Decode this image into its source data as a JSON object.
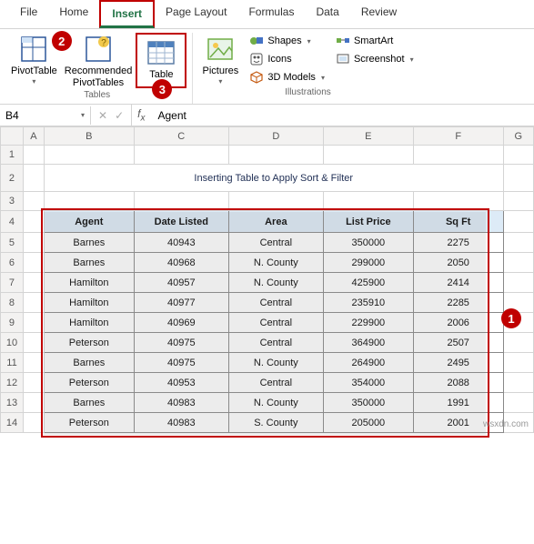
{
  "tabs": [
    "File",
    "Home",
    "Insert",
    "Page Layout",
    "Formulas",
    "Data",
    "Review"
  ],
  "active_tab": "Insert",
  "ribbon": {
    "tables": {
      "pivot": "PivotTable",
      "recommended": "Recommended\nPivotTables",
      "table": "Table",
      "group_label": "Tables"
    },
    "illustrations": {
      "pictures": "Pictures",
      "shapes": "Shapes",
      "icons": "Icons",
      "models": "3D Models",
      "smartart": "SmartArt",
      "screenshot": "Screenshot",
      "group_label": "Illustrations"
    }
  },
  "badges": {
    "b1": "1",
    "b2": "2",
    "b3": "3"
  },
  "namebox": "B4",
  "formula": "Agent",
  "sheet": {
    "title": "Inserting Table to Apply Sort & Filter",
    "cols": [
      "A",
      "B",
      "C",
      "D",
      "E",
      "F",
      "G"
    ],
    "header": [
      "Agent",
      "Date Listed",
      "Area",
      "List Price",
      "Sq Ft"
    ],
    "rows": [
      [
        "Barnes",
        "40943",
        "Central",
        "350000",
        "2275"
      ],
      [
        "Barnes",
        "40968",
        "N. County",
        "299000",
        "2050"
      ],
      [
        "Hamilton",
        "40957",
        "N. County",
        "425900",
        "2414"
      ],
      [
        "Hamilton",
        "40977",
        "Central",
        "235910",
        "2285"
      ],
      [
        "Hamilton",
        "40969",
        "Central",
        "229900",
        "2006"
      ],
      [
        "Peterson",
        "40975",
        "Central",
        "364900",
        "2507"
      ],
      [
        "Barnes",
        "40975",
        "N. County",
        "264900",
        "2495"
      ],
      [
        "Peterson",
        "40953",
        "Central",
        "354000",
        "2088"
      ],
      [
        "Barnes",
        "40983",
        "N. County",
        "350000",
        "1991"
      ],
      [
        "Peterson",
        "40983",
        "S. County",
        "205000",
        "2001"
      ]
    ]
  },
  "watermark": "wsxdn.com"
}
